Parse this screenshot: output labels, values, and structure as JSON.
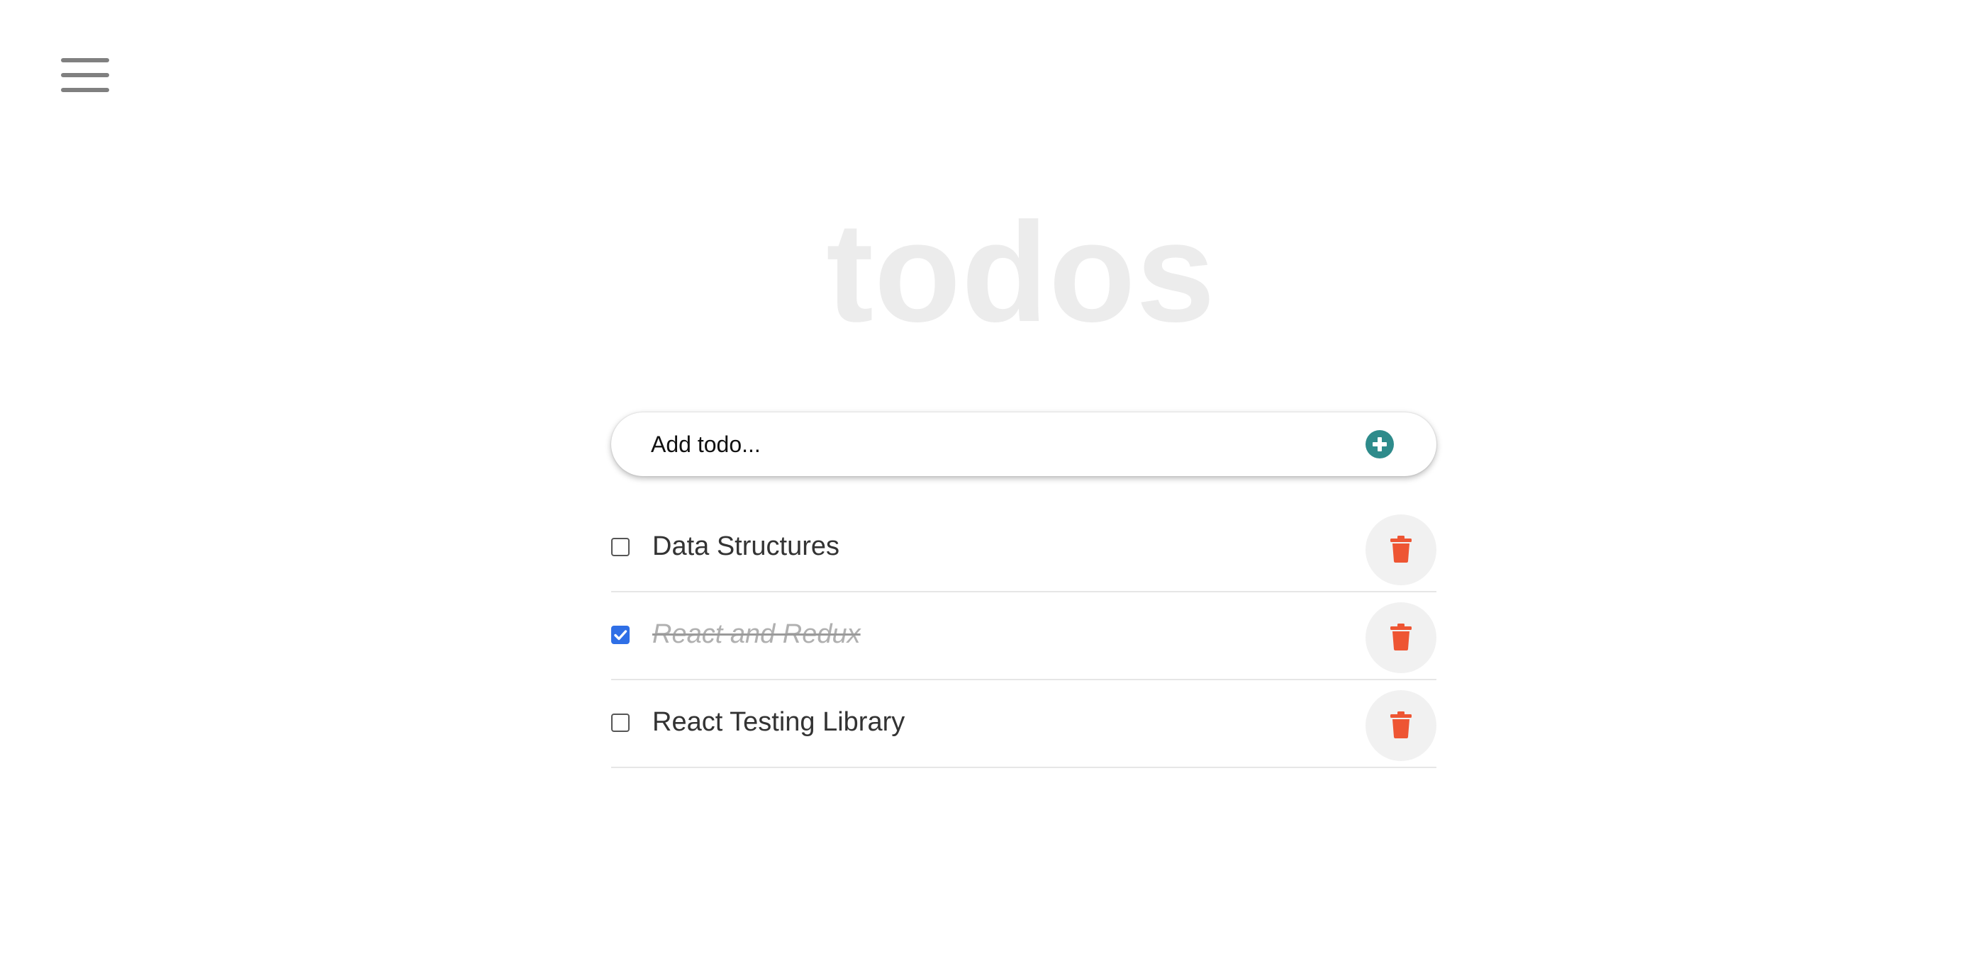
{
  "app": {
    "title": "todos"
  },
  "menu": {
    "icon": "hamburger-menu-icon"
  },
  "add_todo": {
    "placeholder": "Add todo...",
    "button_icon": "plus-circle-icon",
    "accent_color": "#2e8b8b"
  },
  "todos": [
    {
      "label": "Data Structures",
      "completed": false,
      "delete_icon": "trash-icon"
    },
    {
      "label": "React and Redux",
      "completed": true,
      "delete_icon": "trash-icon"
    },
    {
      "label": "React Testing Library",
      "completed": false,
      "delete_icon": "trash-icon"
    }
  ],
  "colors": {
    "title": "#ececec",
    "delete_icon": "#ee5533",
    "checkbox_checked": "#2f6fe6"
  }
}
